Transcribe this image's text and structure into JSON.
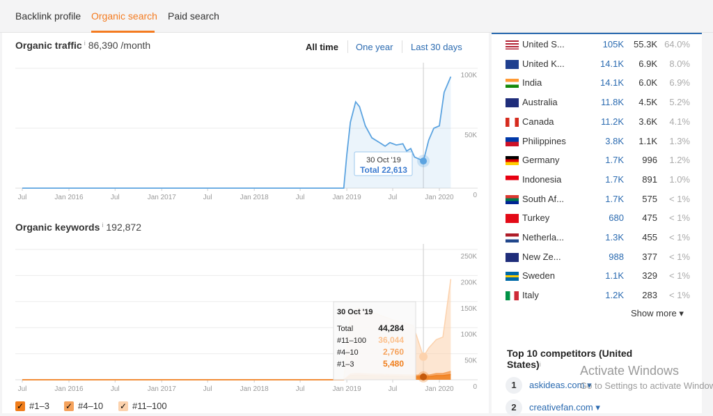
{
  "tabs": [
    {
      "label": "Backlink profile"
    },
    {
      "label": "Organic search"
    },
    {
      "label": "Paid search"
    }
  ],
  "active_tab": "Organic search",
  "traffic": {
    "title": "Organic traffic",
    "info": "i",
    "value": "86,390 /month",
    "ranges": [
      "All time",
      "One year",
      "Last 30 days"
    ],
    "selected_range": "All time",
    "tooltip": {
      "date": "30 Oct '19",
      "label": "Total 22,613"
    }
  },
  "keywords": {
    "title": "Organic keywords",
    "info": "i",
    "value": "192,872",
    "tooltip": {
      "date": "30 Oct '19",
      "rows": [
        {
          "label": "Total",
          "value": "44,284"
        },
        {
          "label": "#11–100",
          "value": "36,044"
        },
        {
          "label": "#4–10",
          "value": "2,760"
        },
        {
          "label": "#1–3",
          "value": "5,480"
        }
      ]
    },
    "legend": [
      {
        "label": "#1–3",
        "checked": true
      },
      {
        "label": "#4–10",
        "checked": true
      },
      {
        "label": "#11–100",
        "checked": true
      }
    ]
  },
  "chart_data": [
    {
      "type": "area",
      "title": "Organic traffic",
      "x_tick_labels": [
        "Jul",
        "Jan 2016",
        "Jul",
        "Jan 2017",
        "Jul",
        "Jan 2018",
        "Jul",
        "Jan 2019",
        "Jul",
        "Jan 2020"
      ],
      "x_ticks": [
        "2015-07-01",
        "2016-01-01",
        "2016-07-01",
        "2017-01-01",
        "2017-07-01",
        "2018-01-01",
        "2018-07-01",
        "2019-01-01",
        "2019-07-01",
        "2020-01-01"
      ],
      "y_tick_labels": [
        "0",
        "50K",
        "100K"
      ],
      "ylim": [
        0,
        100000
      ],
      "grid": true,
      "color": "#5ba3e0",
      "series": [
        {
          "points": [
            [
              "2015-07-01",
              0
            ],
            [
              "2018-12-20",
              0
            ],
            [
              "2019-01-01",
              28000
            ],
            [
              "2019-01-15",
              55000
            ],
            [
              "2019-02-05",
              72000
            ],
            [
              "2019-02-20",
              68000
            ],
            [
              "2019-03-15",
              52000
            ],
            [
              "2019-04-10",
              42000
            ],
            [
              "2019-05-10",
              38000
            ],
            [
              "2019-06-01",
              35000
            ],
            [
              "2019-06-20",
              38000
            ],
            [
              "2019-07-15",
              36000
            ],
            [
              "2019-08-10",
              37000
            ],
            [
              "2019-08-25",
              31000
            ],
            [
              "2019-09-10",
              33000
            ],
            [
              "2019-09-25",
              26000
            ],
            [
              "2019-10-30",
              22613
            ],
            [
              "2019-11-20",
              40000
            ],
            [
              "2019-12-10",
              50000
            ],
            [
              "2020-01-01",
              52000
            ],
            [
              "2020-01-20",
              80000
            ],
            [
              "2020-02-01",
              86000
            ],
            [
              "2020-02-15",
              93000
            ]
          ]
        }
      ]
    },
    {
      "type": "area",
      "stacked": true,
      "title": "Organic keywords",
      "x_tick_labels": [
        "Jul",
        "Jan 2016",
        "Jul",
        "Jan 2017",
        "Jul",
        "Jan 2018",
        "Jul",
        "Jan 2019",
        "Jul",
        "Jan 2020"
      ],
      "x_ticks": [
        "2015-07-01",
        "2016-01-01",
        "2016-07-01",
        "2017-01-01",
        "2017-07-01",
        "2018-01-01",
        "2018-07-01",
        "2019-01-01",
        "2019-07-01",
        "2020-01-01"
      ],
      "y_tick_labels": [
        "0",
        "50K",
        "100K",
        "150K",
        "200K",
        "250K"
      ],
      "ylim": [
        0,
        250000
      ],
      "grid": true,
      "dates": [
        "2015-07-01",
        "2018-12-20",
        "2019-01-15",
        "2019-02-10",
        "2019-04-01",
        "2019-07-01",
        "2019-09-20",
        "2019-10-30",
        "2019-11-20",
        "2019-12-20",
        "2020-01-15",
        "2020-02-15"
      ],
      "series": [
        {
          "name": "#1–3",
          "color": "#f07d1a",
          "values": [
            0,
            0,
            8000,
            9000,
            8000,
            7000,
            6000,
            5480,
            6000,
            8000,
            8000,
            10000
          ]
        },
        {
          "name": "#4–10",
          "color": "#f5a25c",
          "values": [
            0,
            0,
            3000,
            3500,
            3000,
            3000,
            3000,
            2760,
            3000,
            4000,
            4000,
            6000
          ]
        },
        {
          "name": "#11–100",
          "color": "#fcd2ad",
          "values": [
            0,
            0,
            110000,
            125000,
            120000,
            105000,
            95000,
            36044,
            52000,
            65000,
            70000,
            177000
          ]
        }
      ]
    }
  ],
  "countries": [
    {
      "flag": "us",
      "name": "United S...",
      "traffic": "105K",
      "keywords": "55.3K",
      "share": "64.0%"
    },
    {
      "flag": "gb",
      "name": "United K...",
      "traffic": "14.1K",
      "keywords": "6.9K",
      "share": "8.0%"
    },
    {
      "flag": "in",
      "name": "India",
      "traffic": "14.1K",
      "keywords": "6.0K",
      "share": "6.9%"
    },
    {
      "flag": "au",
      "name": "Australia",
      "traffic": "11.8K",
      "keywords": "4.5K",
      "share": "5.2%"
    },
    {
      "flag": "ca",
      "name": "Canada",
      "traffic": "11.2K",
      "keywords": "3.6K",
      "share": "4.1%"
    },
    {
      "flag": "ph",
      "name": "Philippines",
      "traffic": "3.8K",
      "keywords": "1.1K",
      "share": "1.3%"
    },
    {
      "flag": "de",
      "name": "Germany",
      "traffic": "1.7K",
      "keywords": "996",
      "share": "1.2%"
    },
    {
      "flag": "id",
      "name": "Indonesia",
      "traffic": "1.7K",
      "keywords": "891",
      "share": "1.0%"
    },
    {
      "flag": "za",
      "name": "South Af...",
      "traffic": "1.7K",
      "keywords": "575",
      "share": "< 1%"
    },
    {
      "flag": "tr",
      "name": "Turkey",
      "traffic": "680",
      "keywords": "475",
      "share": "< 1%"
    },
    {
      "flag": "nl",
      "name": "Netherla...",
      "traffic": "1.3K",
      "keywords": "455",
      "share": "< 1%"
    },
    {
      "flag": "nz",
      "name": "New Ze...",
      "traffic": "988",
      "keywords": "377",
      "share": "< 1%"
    },
    {
      "flag": "se",
      "name": "Sweden",
      "traffic": "1.1K",
      "keywords": "329",
      "share": "< 1%"
    },
    {
      "flag": "it",
      "name": "Italy",
      "traffic": "1.2K",
      "keywords": "283",
      "share": "< 1%"
    }
  ],
  "show_more": "Show more ▾",
  "competitors": {
    "title": "Top 10 competitors (United States)",
    "info": "i",
    "items": [
      {
        "rank": "1",
        "domain": "askideas.com ▾"
      },
      {
        "rank": "2",
        "domain": "creativefan.com ▾"
      }
    ]
  },
  "watermark": {
    "line1": "Activate Windows",
    "line2": "Go to Settings to activate Windows."
  }
}
